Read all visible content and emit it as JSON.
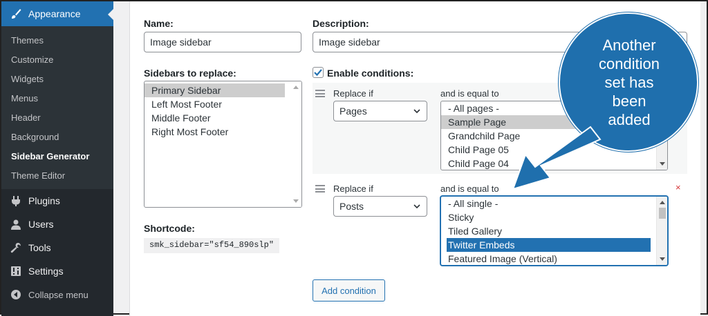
{
  "sidebar": {
    "active_section": "Appearance",
    "sub_items": [
      "Themes",
      "Customize",
      "Widgets",
      "Menus",
      "Header",
      "Background",
      "Sidebar Generator",
      "Theme Editor"
    ],
    "current_sub_item": "Sidebar Generator",
    "main_items": [
      {
        "label": "Plugins",
        "icon": "plugin-icon"
      },
      {
        "label": "Users",
        "icon": "user-icon"
      },
      {
        "label": "Tools",
        "icon": "wrench-icon"
      },
      {
        "label": "Settings",
        "icon": "settings-icon"
      }
    ],
    "collapse_label": "Collapse menu"
  },
  "form": {
    "name_label": "Name:",
    "name_value": "Image sidebar",
    "description_label": "Description:",
    "description_value": "Image sidebar",
    "sidebars_label": "Sidebars to replace:",
    "sidebars_options": [
      "Primary Sidebar",
      "Left Most Footer",
      "Middle Footer",
      "Right Most Footer"
    ],
    "sidebars_selected": "Primary Sidebar",
    "shortcode_label": "Shortcode:",
    "shortcode_value": "smk_sidebar=\"sf54_890slp\"",
    "enable_conditions_label": "Enable conditions:",
    "enable_conditions_checked": true
  },
  "conditions": [
    {
      "replace_if_label": "Replace if",
      "replace_if_value": "Pages",
      "equal_label": "and is equal to",
      "options": [
        "- All pages -",
        "Sample Page",
        "Grandchild Page",
        "Child Page 05",
        "Child Page 04"
      ],
      "selected": "Sample Page"
    },
    {
      "replace_if_label": "Replace if",
      "replace_if_value": "Posts",
      "equal_label": "and is equal to",
      "options": [
        "- All single -",
        "Sticky",
        "Tiled Gallery",
        "Twitter Embeds",
        "Featured Image (Vertical)"
      ],
      "selected": "Twitter Embeds",
      "remove_label": "×"
    }
  ],
  "add_condition_label": "Add condition",
  "callout": {
    "lines": [
      "Another",
      "condition",
      "set has",
      "been",
      "added"
    ],
    "color": "#1f6fad"
  },
  "colors": {
    "accent": "#2271b1",
    "sidebar_bg": "#23282d",
    "danger": "#d63638"
  }
}
